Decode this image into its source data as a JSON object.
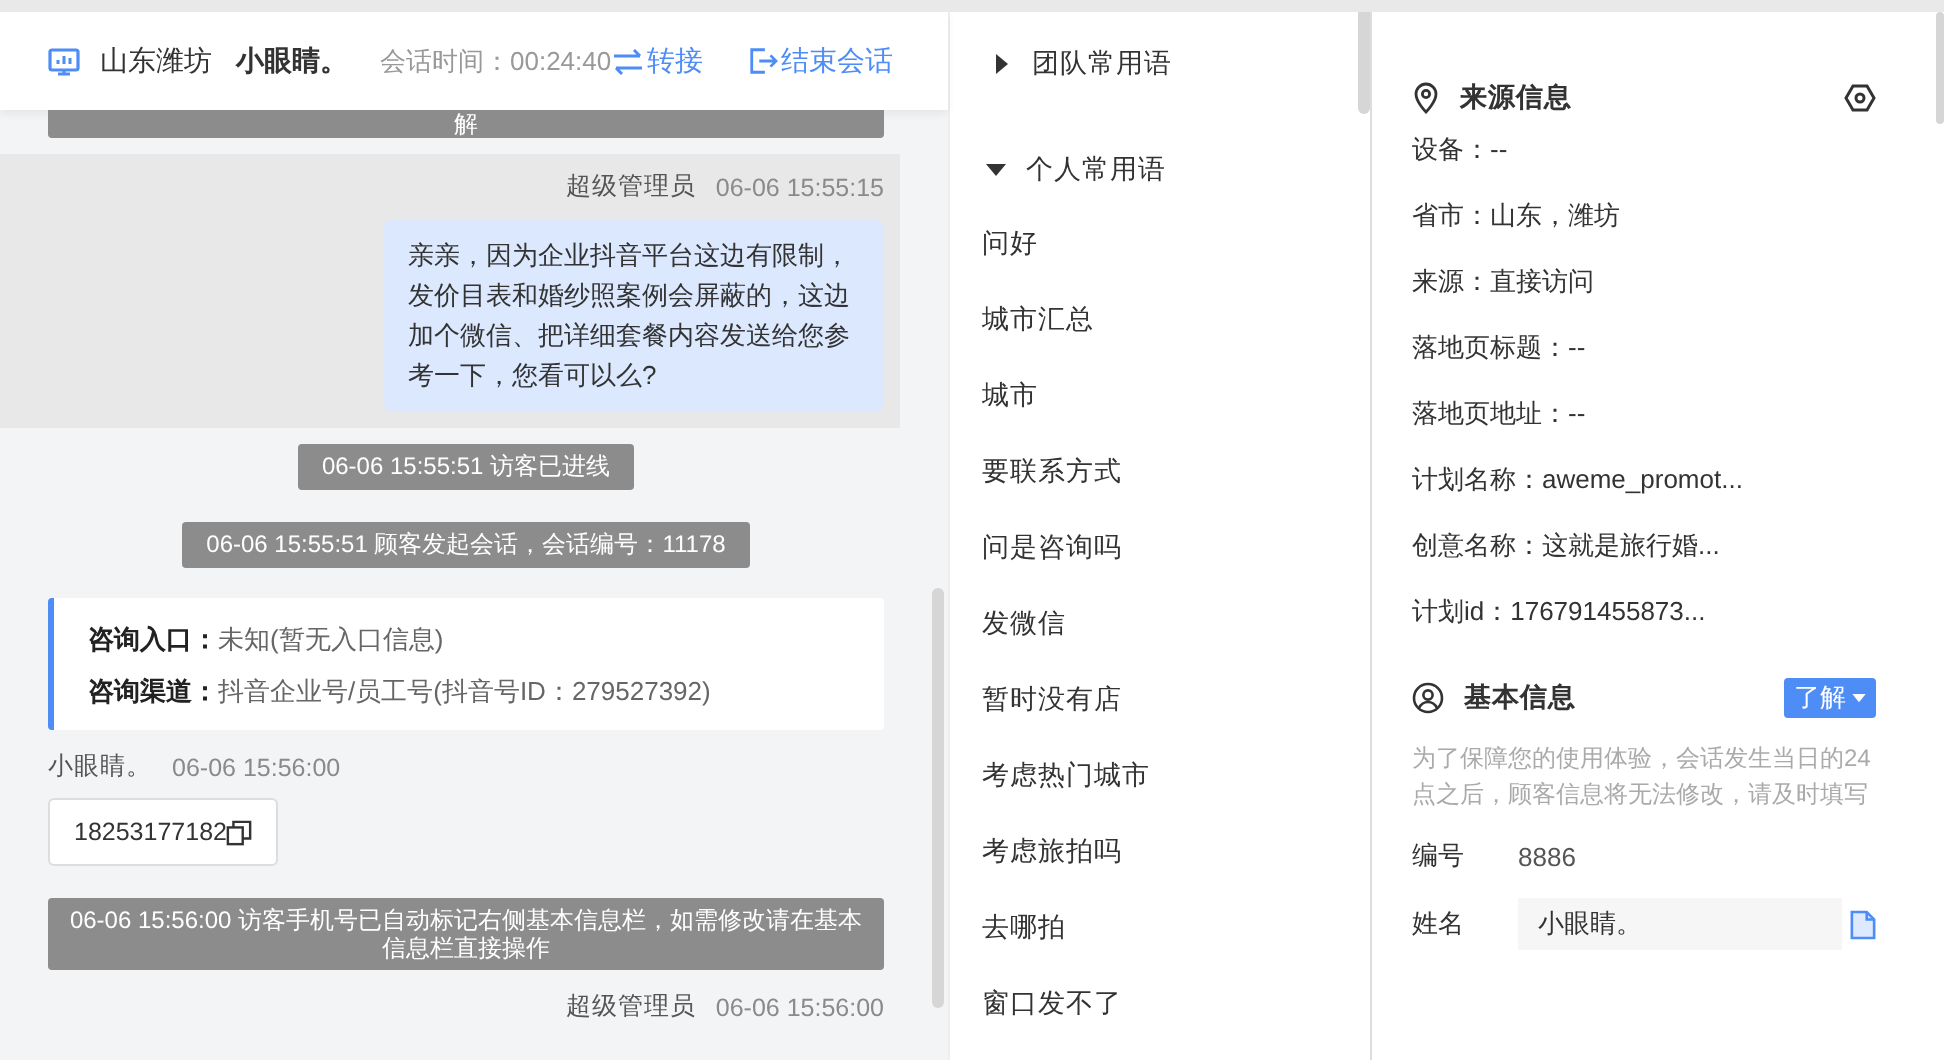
{
  "header": {
    "location": "山东潍坊",
    "visitor": "小眼睛。",
    "session_label": "会话时间：",
    "session_time": "00:24:40",
    "actions": [
      {
        "label": "转接",
        "kind": "transfer"
      },
      {
        "label": "结束会话",
        "kind": "end"
      }
    ]
  },
  "chat": {
    "messages": [
      {
        "kind": "system",
        "text": "解"
      },
      {
        "kind": "agent",
        "sender": "超级管理员",
        "time": "06-06 15:55:15",
        "text": "亲亲，因为企业抖音平台这边有限制，发价目表和婚纱照案例会屏蔽的，这边加个微信、把详细套餐内容发送给您参考一下，您看可以么?",
        "highlighted": true
      },
      {
        "kind": "system",
        "text": "06-06 15:55:51 访客已进线"
      },
      {
        "kind": "system",
        "text": "06-06 15:55:51 顾客发起会话，会话编号：11178"
      },
      {
        "kind": "entry_card",
        "rows": [
          {
            "label": "咨询入口：",
            "value": "未知(暂无入口信息)"
          },
          {
            "label": "咨询渠道：",
            "value": "抖音企业号/员工号(抖音号ID：279527392)"
          }
        ]
      },
      {
        "kind": "visitor",
        "sender": "小眼睛。",
        "time": "06-06 15:56:00",
        "text": "18253177182"
      },
      {
        "kind": "system",
        "text": "06-06 15:56:00 访客手机号已自动标记右侧基本信息栏，如需修改请在基本信息栏直接操作"
      },
      {
        "kind": "agent_header",
        "sender": "超级管理员",
        "time": "06-06 15:56:00"
      }
    ]
  },
  "phrases": {
    "groups": [
      {
        "label": "团队常用语",
        "expanded": false
      },
      {
        "label": "个人常用语",
        "expanded": true,
        "items": [
          "问好",
          "城市汇总",
          "城市",
          "要联系方式",
          "问是咨询吗",
          "发微信",
          "暂时没有店",
          "考虑热门城市",
          "考虑旅拍吗",
          "去哪拍",
          "窗口发不了"
        ]
      }
    ]
  },
  "source_info": {
    "title": "来源信息",
    "lines": [
      "设备：--",
      "省市：山东，潍坊",
      "来源：直接访问",
      "落地页标题：--",
      "落地页地址：--",
      "计划名称：aweme_promot...",
      "创意名称：这就是旅行婚...",
      "计划id：176791455873..."
    ]
  },
  "basic_info": {
    "title": "基本信息",
    "button": "了解",
    "note": "为了保障您的使用体验，会话发生当日的24点之后，顾客信息将无法修改，请及时填写",
    "fields": [
      {
        "label": "编号",
        "kind": "text",
        "value": "8886"
      },
      {
        "label": "姓名",
        "kind": "input",
        "value": "小眼睛。"
      }
    ]
  }
}
